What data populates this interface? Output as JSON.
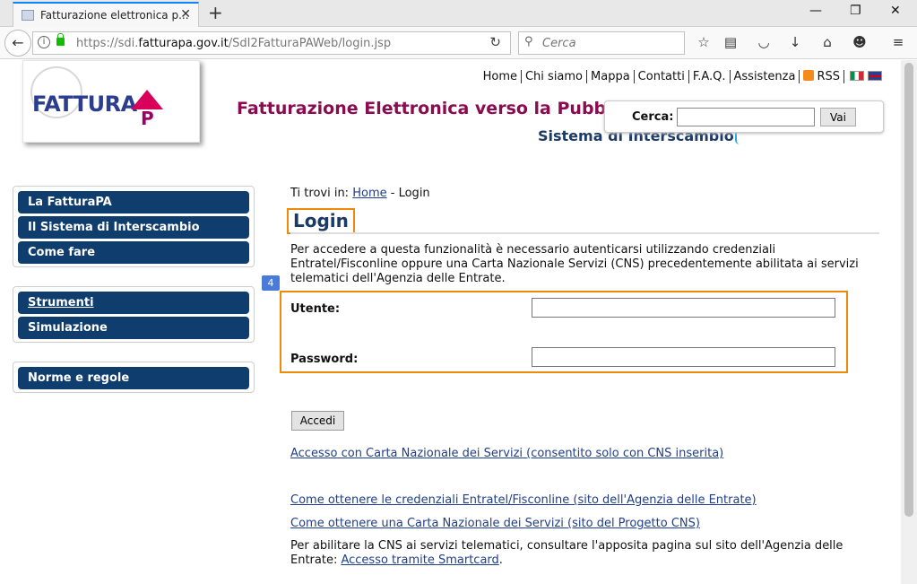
{
  "browser": {
    "tab_title": "Fatturazione elettronica p...",
    "tab_close": "✕",
    "new_tab": "+",
    "url_prefix": "https://sdi.",
    "url_host": "fatturapa.gov.it",
    "url_path": "/SdI2FatturaPAWeb/login.jsp",
    "search_placeholder": "Cerca",
    "window_min": "—",
    "window_max": "❐",
    "window_close": "✕"
  },
  "header": {
    "logo_text": "FATTURA",
    "logo_pa": "P",
    "site_title": "Fatturazione Elettronica verso la Pubblica Amministrazione",
    "subtitle": "Sistema di Interscambio",
    "topnav": [
      "Home",
      "Chi siamo",
      "Mappa",
      "Contatti",
      "F.A.Q.",
      "Assistenza"
    ],
    "rss_label": "RSS",
    "search_label": "Cerca:",
    "search_button": "Vai"
  },
  "sidebar": {
    "group1": [
      "La FatturaPA",
      "Il Sistema di Interscambio",
      "Come fare"
    ],
    "group2": [
      "Strumenti",
      "Simulazione"
    ],
    "group3": [
      "Norme e regole"
    ]
  },
  "content": {
    "breadcrumb_prefix": "Ti trovi in:",
    "breadcrumb_home": "Home",
    "breadcrumb_sep": "-",
    "breadcrumb_current": "Login",
    "heading": "Login",
    "intro": "Per accedere a questa funzionalità è necessario autenticarsi utilizzando credenziali Entratel/Fisconline oppure una Carta Nazionale Servizi (CNS) precedentemente abilitata ai servizi telematici dell'Agenzia delle Entrate.",
    "badge": "4",
    "username_label": "Utente:",
    "password_label": "Password:",
    "login_button": "Accedi",
    "link_cns": "Accesso con Carta Nazionale dei Servizi (consentito solo con CNS inserita)",
    "link_credentials": "Come ottenere le credenziali Entratel/Fisconline (sito dell'Agenzia delle Entrate)",
    "link_cns_get": "Come ottenere una Carta Nazionale dei Servizi (sito del Progetto CNS)",
    "note_text": "Per abilitare la CNS ai servizi telematici, consultare l'apposita pagina sul sito dell'Agenzia delle Entrate: ",
    "note_link": "Accesso tramite Smartcard",
    "note_end": "."
  },
  "colors": {
    "accent_orange": "#f0880a",
    "menu_navy": "#0e3d6e",
    "title_maroon": "#8a0b4f",
    "link_blue": "#1f3f8a"
  }
}
